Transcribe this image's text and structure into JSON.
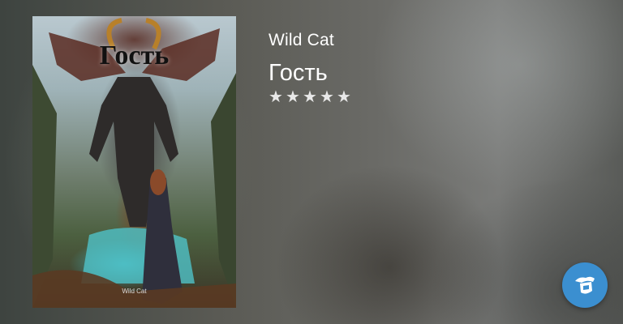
{
  "book": {
    "author": "Wild Cat",
    "title": "Гость",
    "rating": 5,
    "rating_max": 5,
    "star_color": "#e8e8e8"
  },
  "cover": {
    "title": "Гость",
    "author": "Wild Cat"
  },
  "fab": {
    "icon": "reader-hat-icon",
    "color": "#3b8fd0"
  }
}
